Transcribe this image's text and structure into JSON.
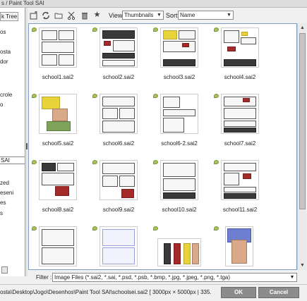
{
  "window": {
    "title": "s / Paint Tool SAI"
  },
  "tree": {
    "tab_label": "k Tree",
    "items": [
      "os",
      "osta",
      "dor",
      "crole",
      "o",
      "SAI",
      "zed",
      "eseni",
      "es",
      "s"
    ]
  },
  "toolbar": {
    "icons": [
      "new-folder-icon",
      "refresh-icon",
      "open-folder-icon",
      "cut-icon",
      "trash-icon",
      "star-icon"
    ],
    "view_label": "View",
    "view_value": "Thumbnails",
    "sort_label": "Sort",
    "sort_value": "Name"
  },
  "files": [
    {
      "name": "school1.sai2"
    },
    {
      "name": "school2.sai2"
    },
    {
      "name": "school3.sai2"
    },
    {
      "name": "school4.sai2"
    },
    {
      "name": "school5.sai2"
    },
    {
      "name": "school6.sai2"
    },
    {
      "name": "school6-2.sai2"
    },
    {
      "name": "school7.sai2"
    },
    {
      "name": "school8.sai2"
    },
    {
      "name": "school9.sai2"
    },
    {
      "name": "school10.sai2"
    },
    {
      "name": "school11.sai2"
    },
    {
      "name": ""
    },
    {
      "name": ""
    },
    {
      "name": ""
    },
    {
      "name": ""
    }
  ],
  "filter": {
    "label": "Filter :",
    "value": "Image Files (*.sai2, *.sai, *.psd, *.psb, *.bmp, *.jpg, *.jpeg, *.png, *.tga)"
  },
  "status": {
    "path": "osta\\Desktop\\Jogo\\Desenhos\\Paint Tool SAI\\schoolsei.sai2  [ 3000px × 5000px  |  335.",
    "ok_label": "OK",
    "cancel_label": "Cancel"
  }
}
